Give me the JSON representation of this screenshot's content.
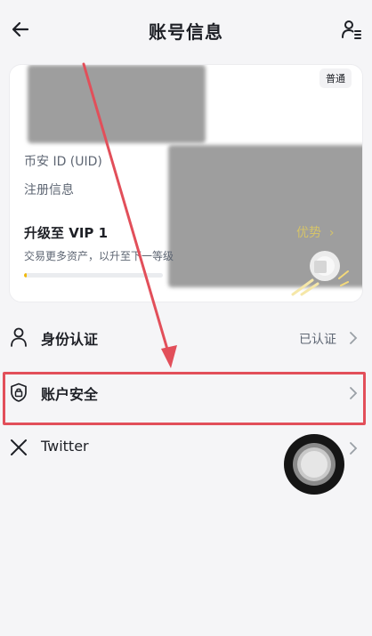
{
  "header": {
    "title": "账号信息",
    "back_icon": "arrow-left-icon",
    "profile_icon": "user-list-icon"
  },
  "account_card": {
    "badge": "普通",
    "uid_label": "币安 ID (UID)",
    "register_label": "注册信息",
    "vip_title": "升级至 VIP 1",
    "vip_subtitle": "交易更多资产，以升至下一等级",
    "vip_link": "优势",
    "vip_progress": 0.02
  },
  "menu": [
    {
      "label": "身份认证",
      "value": "已认证",
      "icon": "person-icon"
    },
    {
      "label": "账户安全",
      "value": "",
      "icon": "shield-lock-icon"
    },
    {
      "label": "Twitter",
      "value": "",
      "icon": "x-logo-icon"
    }
  ],
  "colors": {
    "accent": "#f0b90b",
    "highlight": "#e24f5a",
    "text": "#1e2026",
    "secondary_text": "#5e6673",
    "background": "#f5f5f7"
  }
}
